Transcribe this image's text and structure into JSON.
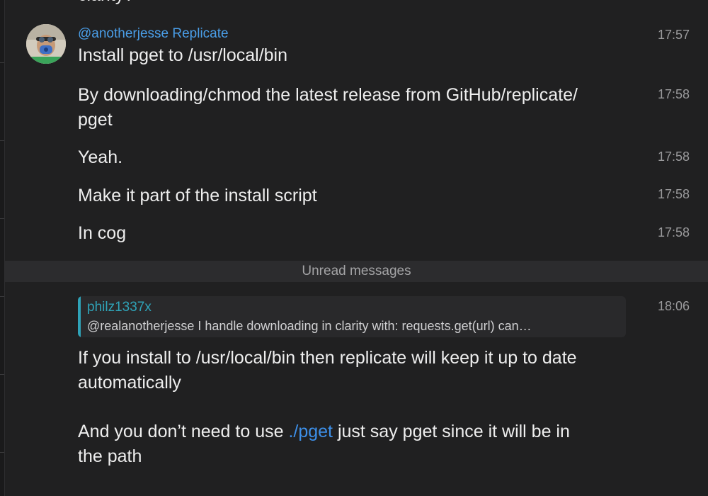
{
  "top_clip_text": "clarity?",
  "message_group_1": {
    "sender": "@anotherjesse Replicate",
    "messages": [
      {
        "lines": [
          "Install pget to /usr/local/bin"
        ],
        "time": "17:57"
      },
      {
        "lines": [
          "By downloading/chmod the latest release from GitHub/replicate/",
          "pget"
        ],
        "time": "17:58"
      },
      {
        "lines": [
          "Yeah."
        ],
        "time": "17:58"
      },
      {
        "lines": [
          "Make it part of the install script"
        ],
        "time": "17:58"
      },
      {
        "lines": [
          "In cog"
        ],
        "time": "17:58"
      }
    ]
  },
  "unread_divider": "Unread messages",
  "message_group_2": {
    "time": "18:06",
    "reply": {
      "author": "philz1337x",
      "text": "@realanotherjesse  I handle downloading in clarity with: requests.get(url)  can…"
    },
    "lines": [
      "If you install to /usr/local/bin then replicate will keep it up to date",
      "automatically"
    ],
    "second_paragraph": {
      "before_link": "And you don’t need to use ",
      "link": "./pget",
      "after_link": " just say pget since it will be in",
      "line2": "the path"
    }
  },
  "colors": {
    "background": "#202021",
    "sender": "#4a9ee8",
    "reply_accent": "#2fa3b8",
    "link": "#3d8fe8"
  }
}
